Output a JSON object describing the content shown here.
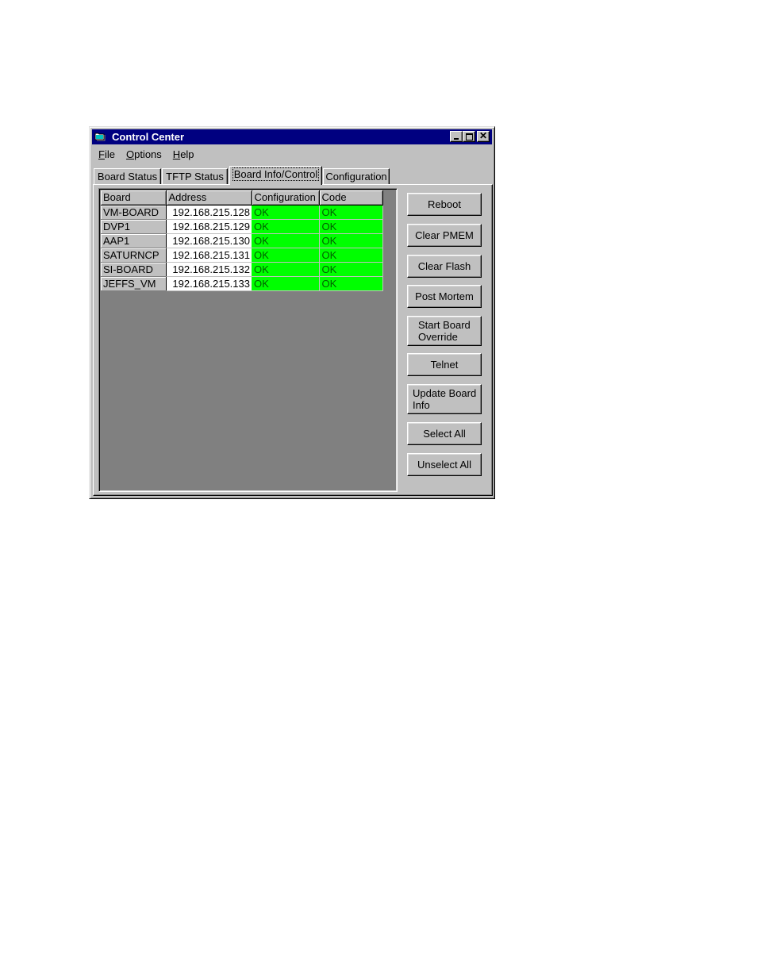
{
  "window": {
    "title": "Control Center",
    "icon": "folder-app-icon",
    "controls": [
      "minimize",
      "maximize",
      "close"
    ]
  },
  "menu": [
    {
      "label": "File",
      "accel": "F"
    },
    {
      "label": "Options",
      "accel": "O"
    },
    {
      "label": "Help",
      "accel": "H"
    }
  ],
  "tabs": [
    {
      "label": "Board Status",
      "active": false
    },
    {
      "label": "TFTP Status",
      "active": false
    },
    {
      "label": "Board Info/Control",
      "active": true
    },
    {
      "label": "Configuration",
      "active": false
    }
  ],
  "table": {
    "columns": [
      "Board",
      "Address",
      "Configuration",
      "Code"
    ],
    "rows": [
      {
        "board": "VM-BOARD",
        "address": "192.168.215.128",
        "configuration": "OK",
        "code": "OK"
      },
      {
        "board": "DVP1",
        "address": "192.168.215.129",
        "configuration": "OK",
        "code": "OK"
      },
      {
        "board": "AAP1",
        "address": "192.168.215.130",
        "configuration": "OK",
        "code": "OK"
      },
      {
        "board": "SATURNCP",
        "address": "192.168.215.131",
        "configuration": "OK",
        "code": "OK"
      },
      {
        "board": "SI-BOARD",
        "address": "192.168.215.132",
        "configuration": "OK",
        "code": "OK"
      },
      {
        "board": "JEFFS_VM",
        "address": "192.168.215.133",
        "configuration": "OK",
        "code": "OK"
      }
    ],
    "status_color_ok": "#00ff00"
  },
  "buttons": {
    "reboot": "Reboot",
    "clear_pmem": "Clear PMEM",
    "clear_flash": "Clear Flash",
    "post_mortem": "Post Mortem",
    "start_board_override": [
      "Start Board",
      "Override"
    ],
    "telnet": "Telnet",
    "update_board_info": [
      "Update Board",
      "Info"
    ],
    "select_all": "Select All",
    "unselect_all": "Unselect All"
  },
  "colors": {
    "titlebar": "#000080",
    "face": "#c0c0c0",
    "grid_bg": "#808080"
  }
}
